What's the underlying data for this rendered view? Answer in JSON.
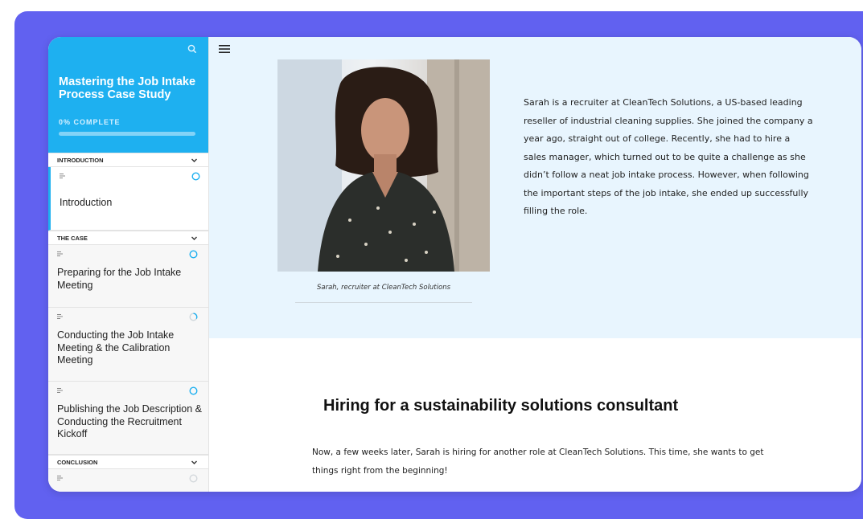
{
  "sidebar": {
    "course_title": "Mastering the Job Intake Process Case Study",
    "progress_label": "0% COMPLETE",
    "progress_percent": 0,
    "sections": [
      {
        "label": "INTRODUCTION",
        "lessons": [
          {
            "title": "Introduction",
            "status": "in-progress",
            "active": true
          }
        ]
      },
      {
        "label": "THE CASE",
        "lessons": [
          {
            "title": "Preparing for the Job Intake Meeting",
            "status": "in-progress"
          },
          {
            "title": "Conducting the Job Intake Meeting & the Calibration Meeting",
            "status": "partial"
          },
          {
            "title": "Publishing the Job Description & Conducting the Recruitment Kickoff",
            "status": "in-progress"
          }
        ]
      },
      {
        "label": "CONCLUSION",
        "lessons": [
          {
            "title": "",
            "status": "not-started"
          }
        ]
      }
    ]
  },
  "icons": {
    "search": "search-icon",
    "menu": "hamburger-menu-icon",
    "chevron": "chevron-down-icon",
    "lesson_type": "text-lesson-icon",
    "status": "progress-circle-icon"
  },
  "colors": {
    "frame": "#6161f0",
    "accent": "#1eb0f0",
    "hero_bg": "#e8f5fe"
  },
  "main": {
    "caption": "Sarah, recruiter at CleanTech Solutions",
    "intro_text": "Sarah is a recruiter at CleanTech Solutions, a US-based leading reseller of industrial cleaning supplies. She joined the company a year ago, straight out of college. Recently, she had to hire a sales manager, which turned out to be quite a challenge as she didn’t follow a neat job intake process. However, when following the important steps of the job intake, she ended up successfully filling the role.",
    "heading": "Hiring for a sustainability solutions consultant",
    "body_text": "Now, a few weeks later, Sarah is hiring for another role at CleanTech Solutions. This time, she wants to get things right from the beginning!"
  }
}
